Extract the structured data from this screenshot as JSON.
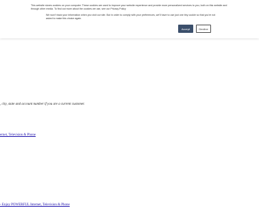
{
  "cookie_banner": {
    "text_1": "This website stores cookies on your computer. These cookies are used to improve your website experience and provide more personalized services to you, both on this website and through other media. To find out more about the cookies we use, see our Privacy Policy",
    "text_2": "We won't track your information when you visit our site. But in order to comply with your preferences, we'll have to use just one tiny cookie so that you're not asked to make this choice again.",
    "accept_label": "Accept",
    "decline_label": "Decline"
  },
  "main": {
    "body_text": ", city, state and account number if you are a current customer.",
    "link_1": "ernet, Television & Phone",
    "link_2": "- Enjoy POWERFUL Internet, Television & Phone"
  },
  "colors": {
    "accept_bg": "#3b4f6b",
    "link": "#1a0dab"
  }
}
